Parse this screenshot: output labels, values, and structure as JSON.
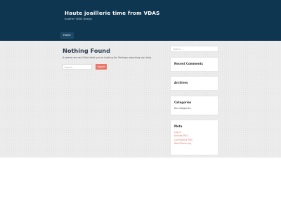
{
  "header": {
    "site_title": "Haute joaillerie time from VDAS",
    "tagline": "Another VDAS Design"
  },
  "nav": {
    "items": [
      {
        "label": "Home"
      }
    ]
  },
  "main": {
    "title": "Nothing Found",
    "message": "It seems we can't find what you're looking for. Perhaps searching can help.",
    "search_placeholder": "Search ...",
    "search_button": "Search"
  },
  "sidebar": {
    "search_placeholder": "Search ...",
    "recent_comments_title": "Recent Comments",
    "archives_title": "Archives",
    "categories_title": "Categories",
    "categories_text": "No categories",
    "meta_title": "Meta",
    "meta_links": [
      "Log in",
      "Entries RSS",
      "Comments RSS",
      "WordPress.org"
    ]
  }
}
